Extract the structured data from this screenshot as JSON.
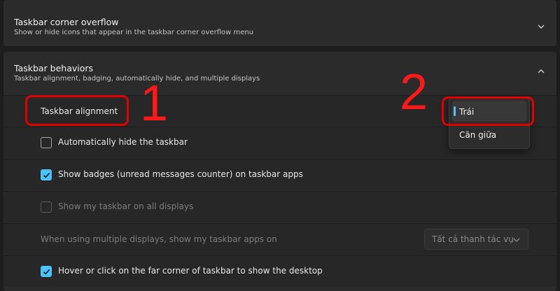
{
  "sections": {
    "corner_overflow": {
      "title": "Taskbar corner overflow",
      "subtitle": "Show or hide icons that appear in the taskbar corner overflow menu",
      "chevron_icon": "chevron-down-icon"
    },
    "behaviors": {
      "title": "Taskbar behaviors",
      "subtitle": "Taskbar alignment, badging, automatically hide, and multiple displays",
      "chevron_icon": "chevron-up-icon",
      "alignment_label": "Taskbar alignment",
      "alignment_options": [
        "Trái",
        "Căn giữa"
      ],
      "alignment_selected": "Trái",
      "auto_hide": {
        "label": "Automatically hide the taskbar",
        "checked": false
      },
      "badges": {
        "label": "Show badges (unread messages counter) on taskbar apps",
        "checked": true
      },
      "all_displays": {
        "label": "Show my taskbar on all displays",
        "checked": false,
        "disabled": true
      },
      "multi_display": {
        "label": "When using multiple displays, show my taskbar apps on",
        "value": "Tất cả thanh tác vụ",
        "disabled": true
      },
      "desktop_corner": {
        "label": "Hover or click on the far corner of taskbar to show the desktop",
        "checked": true
      }
    }
  },
  "annotations": {
    "step1": "1",
    "step2": "2",
    "color": "#e00000"
  },
  "accent_color": "#4cc2ff"
}
